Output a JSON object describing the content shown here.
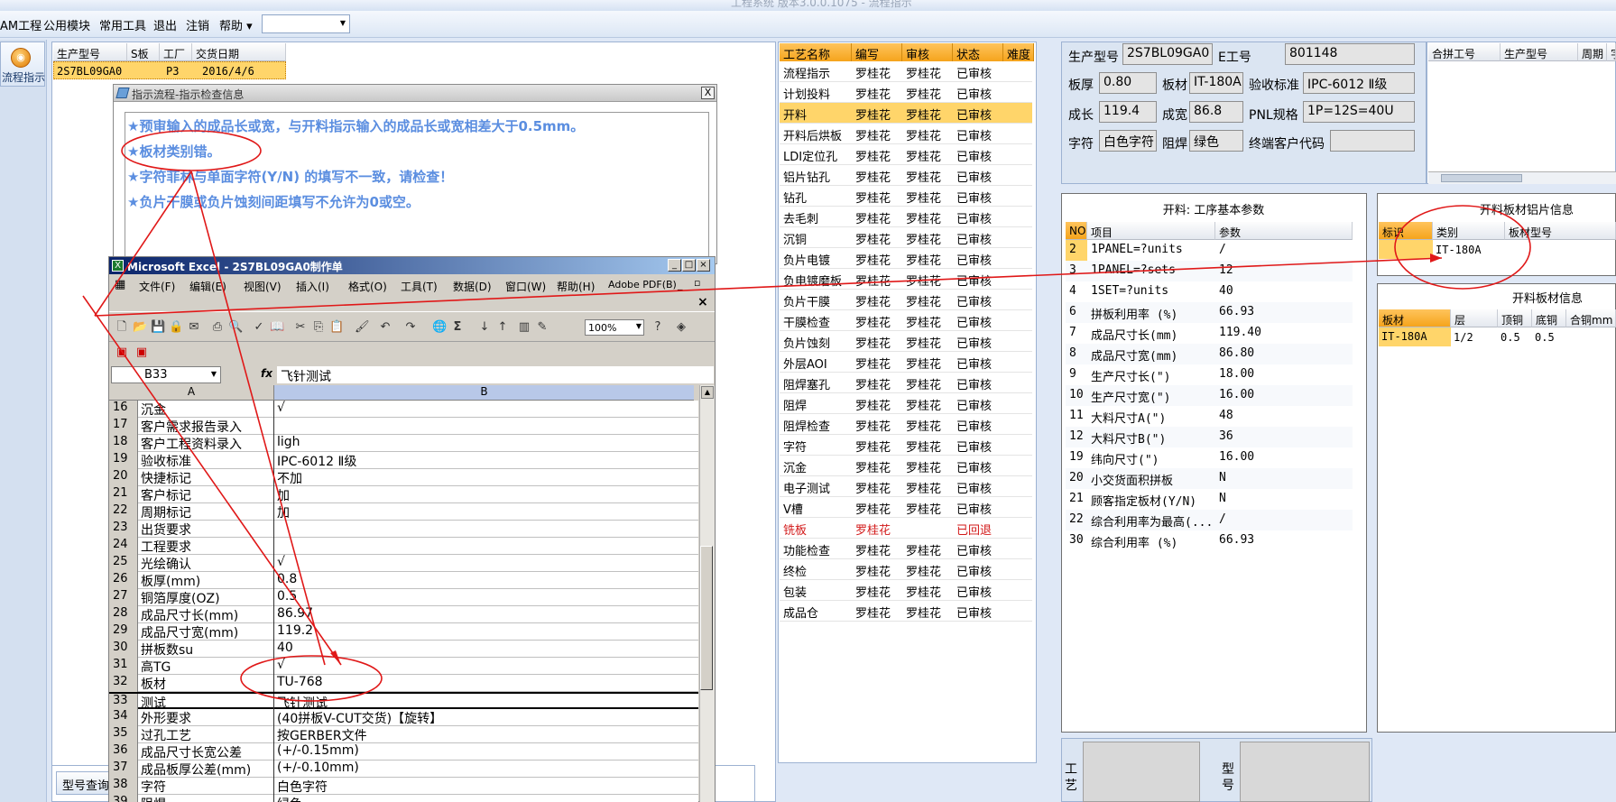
{
  "title": {
    "text": "工程系统 版本3.0.0.1075 - 流程指示"
  },
  "menu": [
    {
      "label": "AM工程"
    },
    {
      "label": "公用模块"
    },
    {
      "label": "常用工具"
    },
    {
      "label": "退出"
    },
    {
      "label": "注销"
    },
    {
      "label": "帮助"
    }
  ],
  "leftbar": {
    "flow_label": "流程指示"
  },
  "job_list": {
    "headers": [
      "生产型号",
      "S板",
      "工厂",
      "交货日期"
    ],
    "row": {
      "model": "2S7BL09GA0",
      "factory": "P3",
      "date": "2016/4/6"
    }
  },
  "dialog": {
    "title": "指示流程-指示检查信息",
    "close": "X",
    "messages": [
      "★预审输入的成品长或宽，与开料指示输入的成品长或宽相差大于0.5mm。",
      "★板材类别错。",
      "★字符菲林与单面字符(Y/N) 的填写不一致，请检查！",
      "★负片干膜或负片蚀刻间距填写不允许为0或空。"
    ]
  },
  "excel": {
    "title": "Microsoft Excel - 2S7BL09GA0制作单",
    "menu": [
      "文件(F)",
      "编辑(E)",
      "视图(V)",
      "插入(I)",
      "格式(O)",
      "工具(T)",
      "数据(D)",
      "窗口(W)",
      "帮助(H)",
      "Adobe PDF(B)"
    ],
    "zoom": "100%",
    "name_box": "B33",
    "fx": "fx",
    "formula": "飞针测试",
    "col_a": "A",
    "col_b": "B",
    "rows": [
      {
        "n": "16",
        "a": "沉金",
        "b": "√"
      },
      {
        "n": "17",
        "a": "客户需求报告录入",
        "b": ""
      },
      {
        "n": "18",
        "a": "客户工程资料录入",
        "b": "ligh"
      },
      {
        "n": "19",
        "a": "验收标准",
        "b": "IPC-6012 Ⅱ级"
      },
      {
        "n": "20",
        "a": "快捷标记",
        "b": "不加"
      },
      {
        "n": "21",
        "a": "客户标记",
        "b": "加"
      },
      {
        "n": "22",
        "a": "周期标记",
        "b": "加"
      },
      {
        "n": "23",
        "a": "出货要求",
        "b": ""
      },
      {
        "n": "24",
        "a": "工程要求",
        "b": ""
      },
      {
        "n": "25",
        "a": "光绘确认",
        "b": "√"
      },
      {
        "n": "26",
        "a": "板厚(mm)",
        "b": "0.8"
      },
      {
        "n": "27",
        "a": "铜箔厚度(OZ)",
        "b": "0.5"
      },
      {
        "n": "28",
        "a": "成品尺寸长(mm)",
        "b": "86.97"
      },
      {
        "n": "29",
        "a": "成品尺寸宽(mm)",
        "b": "119.2"
      },
      {
        "n": "30",
        "a": "拼板数su",
        "b": "40"
      },
      {
        "n": "31",
        "a": "高TG",
        "b": "√"
      },
      {
        "n": "32",
        "a": "板材",
        "b": "TU-768"
      },
      {
        "n": "33",
        "a": "测试",
        "b": "飞针测试"
      },
      {
        "n": "34",
        "a": "外形要求",
        "b": "(40拼板V-CUT交货)【旋转】"
      },
      {
        "n": "35",
        "a": "过孔工艺",
        "b": "按GERBER文件"
      },
      {
        "n": "36",
        "a": "成品尺寸长宽公差",
        "b": "(+/-0.15mm)"
      },
      {
        "n": "37",
        "a": "成品板厚公差(mm)",
        "b": "(+/-0.10mm)"
      },
      {
        "n": "38",
        "a": "字符",
        "b": "白色字符"
      },
      {
        "n": "39",
        "a": "阻焊",
        "b": "绿色"
      }
    ]
  },
  "process": {
    "headers": [
      "工艺名称",
      "编写",
      "审核",
      "状态",
      "难度"
    ],
    "rows": [
      {
        "name": "流程指示",
        "w": "罗桂花",
        "r": "罗桂花",
        "s": "已审核"
      },
      {
        "name": "计划投料",
        "w": "罗桂花",
        "r": "罗桂花",
        "s": "已审核"
      },
      {
        "name": "开料",
        "w": "罗桂花",
        "r": "罗桂花",
        "s": "已审核"
      },
      {
        "name": "开料后烘板",
        "w": "罗桂花",
        "r": "罗桂花",
        "s": "已审核"
      },
      {
        "name": "LDI定位孔",
        "w": "罗桂花",
        "r": "罗桂花",
        "s": "已审核"
      },
      {
        "name": "铝片钻孔",
        "w": "罗桂花",
        "r": "罗桂花",
        "s": "已审核"
      },
      {
        "name": "钻孔",
        "w": "罗桂花",
        "r": "罗桂花",
        "s": "已审核"
      },
      {
        "name": "去毛刺",
        "w": "罗桂花",
        "r": "罗桂花",
        "s": "已审核"
      },
      {
        "name": "沉铜",
        "w": "罗桂花",
        "r": "罗桂花",
        "s": "已审核"
      },
      {
        "name": "负片电镀",
        "w": "罗桂花",
        "r": "罗桂花",
        "s": "已审核"
      },
      {
        "name": "负电镀磨板",
        "w": "罗桂花",
        "r": "罗桂花",
        "s": "已审核"
      },
      {
        "name": "负片干膜",
        "w": "罗桂花",
        "r": "罗桂花",
        "s": "已审核"
      },
      {
        "name": "干膜检查",
        "w": "罗桂花",
        "r": "罗桂花",
        "s": "已审核"
      },
      {
        "name": "负片蚀刻",
        "w": "罗桂花",
        "r": "罗桂花",
        "s": "已审核"
      },
      {
        "name": "外层AOI",
        "w": "罗桂花",
        "r": "罗桂花",
        "s": "已审核"
      },
      {
        "name": "阻焊塞孔",
        "w": "罗桂花",
        "r": "罗桂花",
        "s": "已审核"
      },
      {
        "name": "阻焊",
        "w": "罗桂花",
        "r": "罗桂花",
        "s": "已审核"
      },
      {
        "name": "阻焊检查",
        "w": "罗桂花",
        "r": "罗桂花",
        "s": "已审核"
      },
      {
        "name": "字符",
        "w": "罗桂花",
        "r": "罗桂花",
        "s": "已审核"
      },
      {
        "name": "沉金",
        "w": "罗桂花",
        "r": "罗桂花",
        "s": "已审核"
      },
      {
        "name": "电子测试",
        "w": "罗桂花",
        "r": "罗桂花",
        "s": "已审核"
      },
      {
        "name": "V槽",
        "w": "罗桂花",
        "r": "罗桂花",
        "s": "已审核"
      },
      {
        "name": "铣板",
        "w": "罗桂花",
        "r": "",
        "s": "已回退"
      },
      {
        "name": "功能检查",
        "w": "罗桂花",
        "r": "罗桂花",
        "s": "已审核"
      },
      {
        "name": "终检",
        "w": "罗桂花",
        "r": "罗桂花",
        "s": "已审核"
      },
      {
        "name": "包装",
        "w": "罗桂花",
        "r": "罗桂花",
        "s": "已审核"
      },
      {
        "name": "成品仓",
        "w": "罗桂花",
        "r": "罗桂花",
        "s": "已审核"
      }
    ]
  },
  "info": {
    "model_label": "生产型号",
    "model": "2S7BL09GA0",
    "eno_label": "E工号",
    "eno": "801148",
    "thick_label": "板厚",
    "thick": "0.80",
    "mat_label": "板材",
    "mat": "IT-180A",
    "std_label": "验收标准",
    "std": "IPC-6012 Ⅱ级",
    "len_label": "成长",
    "len": "119.4",
    "wid_label": "成宽",
    "wid": "86.8",
    "pnl_label": "PNL规格",
    "pnl": "1P=12S=40U",
    "char_label": "字符",
    "char": "白色字符",
    "mask_label": "阻焊",
    "mask": "绿色",
    "cust_label": "终端客户代码",
    "cust": ""
  },
  "combine": {
    "headers": [
      "合拼工号",
      "生产型号",
      "周期",
      "字"
    ]
  },
  "params": {
    "title": "开料: 工序基本参数",
    "headers": [
      "NO",
      "项目",
      "参数"
    ],
    "rows": [
      {
        "no": "2",
        "item": "1PANEL=?units",
        "val": "/"
      },
      {
        "no": "3",
        "item": "1PANEL=?sets",
        "val": "12"
      },
      {
        "no": "4",
        "item": "1SET=?units",
        "val": "40"
      },
      {
        "no": "6",
        "item": "拼板利用率 (%)",
        "val": "66.93"
      },
      {
        "no": "7",
        "item": "成品尺寸长(mm)",
        "val": "119.40"
      },
      {
        "no": "8",
        "item": "成品尺寸宽(mm)",
        "val": "86.80"
      },
      {
        "no": "9",
        "item": "生产尺寸长(\")",
        "val": "18.00"
      },
      {
        "no": "10",
        "item": "生产尺寸宽(\")",
        "val": "16.00"
      },
      {
        "no": "11",
        "item": "大料尺寸A(\")",
        "val": "48"
      },
      {
        "no": "12",
        "item": "大料尺寸B(\")",
        "val": "36"
      },
      {
        "no": "19",
        "item": "纬向尺寸(\")",
        "val": "16.00"
      },
      {
        "no": "20",
        "item": "小交货面积拼板",
        "val": "N"
      },
      {
        "no": "21",
        "item": "顾客指定板材(Y/N)",
        "val": "N"
      },
      {
        "no": "22",
        "item": "综合利用率为最高(...",
        "val": "/"
      },
      {
        "no": "30",
        "item": "综合利用率 (%)",
        "val": "66.93"
      }
    ]
  },
  "alu": {
    "title": "开料板材铝片信息",
    "headers": [
      "标识",
      "类别",
      "板材型号"
    ],
    "row": {
      "flag": "",
      "type": "IT-180A",
      "model": ""
    }
  },
  "plate": {
    "title": "开料板材信息",
    "headers": [
      "板材",
      "层",
      "顶铜",
      "底铜",
      "合铜mm"
    ],
    "row": {
      "mat": "IT-180A",
      "layer": "1/2",
      "top": "0.5",
      "bottom": "0.5",
      "total": ""
    }
  },
  "bottom": {
    "tab": "型号查询",
    "craft_label": "工艺",
    "model_label": "型号"
  }
}
